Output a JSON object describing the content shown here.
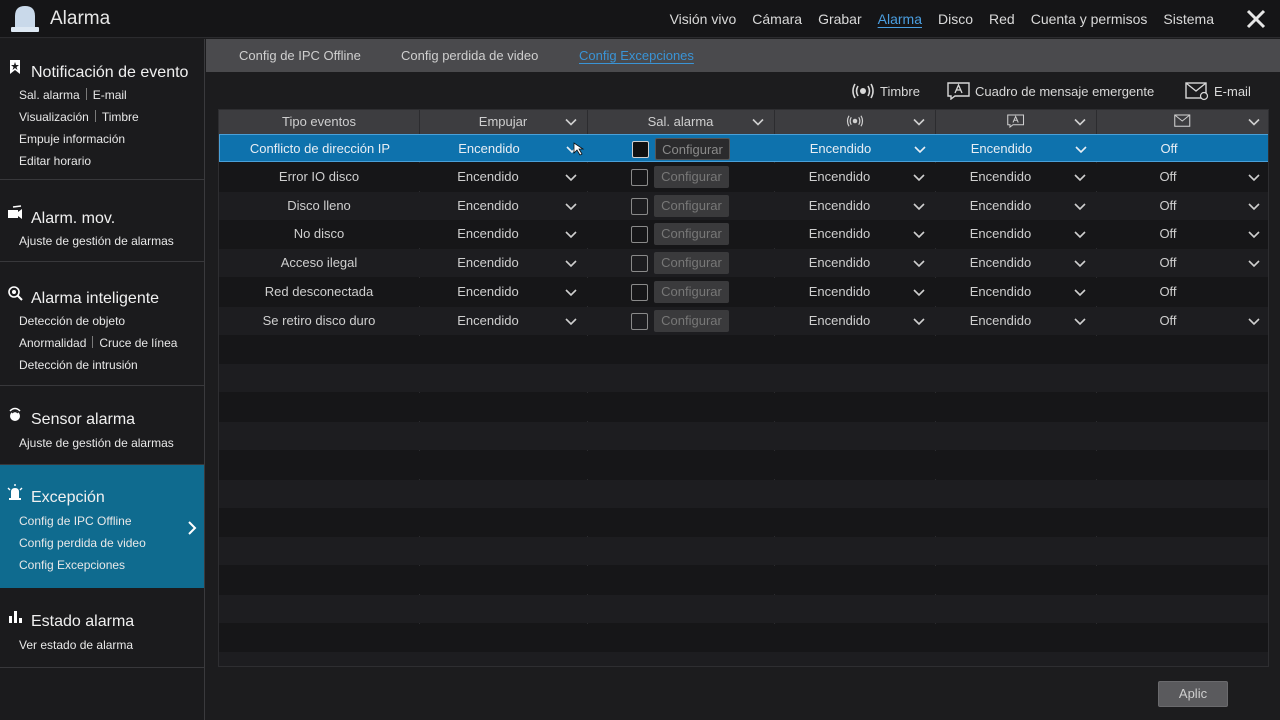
{
  "app": {
    "title": "Alarma"
  },
  "topnav": [
    {
      "label": "Visión vivo",
      "active": false
    },
    {
      "label": "Cámara",
      "active": false
    },
    {
      "label": "Grabar",
      "active": false
    },
    {
      "label": "Alarma",
      "active": true
    },
    {
      "label": "Disco",
      "active": false
    },
    {
      "label": "Red",
      "active": false
    },
    {
      "label": "Cuenta y permisos",
      "active": false
    },
    {
      "label": "Sistema",
      "active": false
    }
  ],
  "sidebar": {
    "groups": [
      {
        "title": "Notificación de evento",
        "icon": "bookmark-star-icon",
        "items": [
          [
            "Sal. alarma",
            "E-mail"
          ],
          [
            "Visualización",
            "Timbre"
          ],
          [
            "Empuje información"
          ],
          [
            "Editar horario"
          ]
        ]
      },
      {
        "title": "Alarm. mov.",
        "icon": "motion-icon",
        "items": [
          [
            "Ajuste de gestión de alarmas"
          ]
        ]
      },
      {
        "title": "Alarma inteligente",
        "icon": "smart-search-icon",
        "items": [
          [
            "Detección de objeto"
          ],
          [
            "Anormalidad",
            "Cruce de línea"
          ],
          [
            "Detección de intrusión"
          ]
        ]
      },
      {
        "title": "Sensor alarma",
        "icon": "sensor-icon",
        "items": [
          [
            "Ajuste de gestión de alarmas"
          ]
        ]
      },
      {
        "title": "Excepción",
        "icon": "alarm-light-icon",
        "items": [
          [
            "Config de IPC Offline"
          ],
          [
            "Config perdida de video"
          ],
          [
            "Config Excepciones"
          ]
        ]
      },
      {
        "title": "Estado alarma",
        "icon": "status-bars-icon",
        "items": [
          [
            "Ver estado de alarma"
          ]
        ]
      }
    ]
  },
  "subtabs": [
    {
      "label": "Config de IPC Offline",
      "active": false
    },
    {
      "label": "Config perdida de video",
      "active": false
    },
    {
      "label": "Config Excepciones",
      "active": true
    }
  ],
  "legend": [
    {
      "icon": "buzzer-icon",
      "label": "Timbre"
    },
    {
      "icon": "popup-message-icon",
      "label": "Cuadro de mensaje emergente"
    },
    {
      "icon": "email-icon",
      "label": "E-mail"
    }
  ],
  "table": {
    "headers": [
      "Tipo eventos",
      "Empujar",
      "Sal. alarma",
      "buzzer-icon",
      "popup-message-icon",
      "email-icon"
    ],
    "configure_label": "Configurar",
    "rows": [
      {
        "event": "Conflicto de dirección IP",
        "push": "Encendido",
        "alarm_out": false,
        "buzzer": "Encendido",
        "popup": "Encendido",
        "email": "Off",
        "email_dropdown": false,
        "selected": true
      },
      {
        "event": "Error IO disco",
        "push": "Encendido",
        "alarm_out": false,
        "buzzer": "Encendido",
        "popup": "Encendido",
        "email": "Off",
        "email_dropdown": true,
        "selected": false
      },
      {
        "event": "Disco lleno",
        "push": "Encendido",
        "alarm_out": false,
        "buzzer": "Encendido",
        "popup": "Encendido",
        "email": "Off",
        "email_dropdown": true,
        "selected": false
      },
      {
        "event": "No disco",
        "push": "Encendido",
        "alarm_out": false,
        "buzzer": "Encendido",
        "popup": "Encendido",
        "email": "Off",
        "email_dropdown": true,
        "selected": false
      },
      {
        "event": "Acceso ilegal",
        "push": "Encendido",
        "alarm_out": false,
        "buzzer": "Encendido",
        "popup": "Encendido",
        "email": "Off",
        "email_dropdown": true,
        "selected": false
      },
      {
        "event": "Red desconectada",
        "push": "Encendido",
        "alarm_out": false,
        "buzzer": "Encendido",
        "popup": "Encendido",
        "email": "Off",
        "email_dropdown": false,
        "selected": false
      },
      {
        "event": "Se retiro disco duro",
        "push": "Encendido",
        "alarm_out": false,
        "buzzer": "Encendido",
        "popup": "Encendido",
        "email": "Off",
        "email_dropdown": true,
        "selected": false
      }
    ]
  },
  "apply_label": "Aplic",
  "colors": {
    "accent": "#0f6b8f",
    "selected_row": "#0e72ad",
    "link": "#3a94d6"
  }
}
